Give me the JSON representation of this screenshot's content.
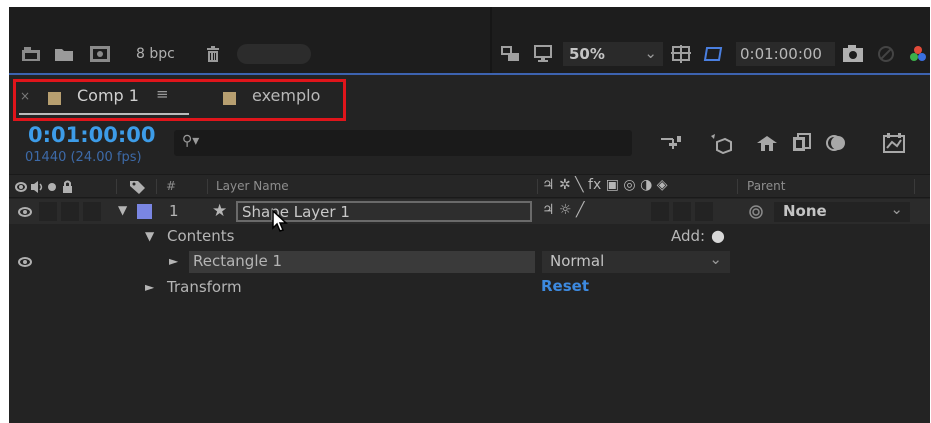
{
  "toolbar": {
    "depth_label": "8 bpc",
    "zoom": "50%",
    "zoom_chevron": "⌄",
    "timecode": "0:01:00:00"
  },
  "tabs": [
    {
      "label": "Comp 1",
      "close": "×",
      "menu": "≡",
      "active": true
    },
    {
      "label": "exemplo",
      "active": false
    }
  ],
  "timeline": {
    "current_time": "0:01:00:00",
    "frame_info": "01440 (24.00 fps)",
    "search_glyph": "⚲▾",
    "columns": {
      "number": "#",
      "layer_name": "Layer Name",
      "switches": "♃ ✲ ╲ fx ▣ ◎ ◑ ◈",
      "parent": "Parent"
    }
  },
  "layers": [
    {
      "index": "1",
      "name": "Shape Layer 1",
      "star": "★",
      "switch_icons": "♃ ☼ ╱",
      "parent_value": "None",
      "parent_chevron": "⌄",
      "label_color": "#7a86e3"
    }
  ],
  "contents": {
    "label": "Contents",
    "add_label": "Add:",
    "add_icon": "●"
  },
  "rectangle": {
    "name": "Rectangle 1",
    "mode": "Normal",
    "mode_chevron": "⌄"
  },
  "transform": {
    "label": "Transform",
    "reset": "Reset"
  },
  "colors": {
    "accent_blue": "#3d9ce8",
    "reset_blue": "#3d8ae0",
    "highlight_red": "#e0151b"
  }
}
